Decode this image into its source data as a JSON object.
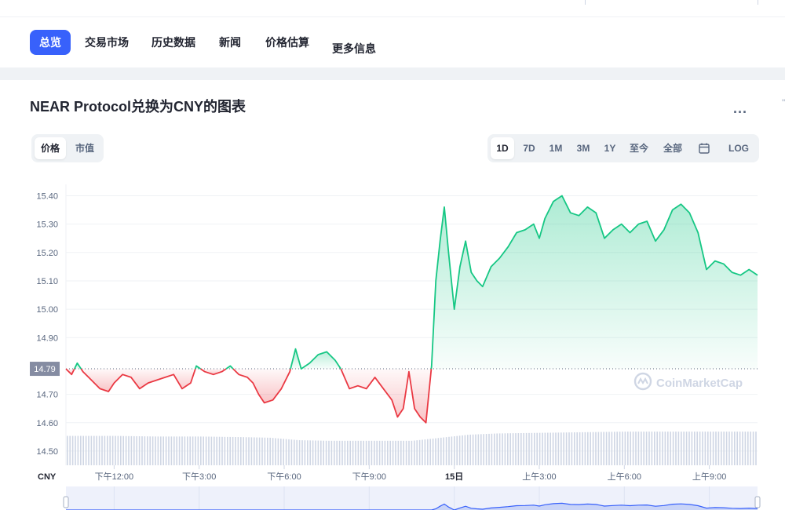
{
  "nav": {
    "items": [
      {
        "label": "总览",
        "active": true
      },
      {
        "label": "交易市场",
        "active": false
      },
      {
        "label": "历史数据",
        "active": false
      },
      {
        "label": "新闻",
        "active": false
      },
      {
        "label": "价格估算",
        "active": false
      },
      {
        "label": "更多信息",
        "active": false
      }
    ]
  },
  "chart_header": {
    "title": "NEAR Protocol兑换为CNY的图表",
    "more_label": "...",
    "edge_mark": "\"",
    "view_toggle": [
      "价格",
      "市值"
    ],
    "view_active": "价格",
    "ranges": [
      "1D",
      "7D",
      "1M",
      "3M",
      "1Y",
      "至今",
      "全部"
    ],
    "range_active": "1D",
    "calendar_icon": "calendar-icon",
    "log_label": "LOG"
  },
  "colors": {
    "up": "#16c784",
    "down": "#ea3943",
    "accent": "#3861fb",
    "volume": "#cfd6e4"
  },
  "chart_data": {
    "type": "line",
    "currency_label": "CNY",
    "watermark": "CoinMarketCap",
    "baseline_value": 14.79,
    "baseline_label": "14.79",
    "ylim": [
      14.45,
      15.44
    ],
    "yticks": [
      15.4,
      15.3,
      15.2,
      15.1,
      15.0,
      14.9,
      14.7,
      14.6,
      14.5
    ],
    "ytick_labels": [
      "15.40",
      "15.30",
      "15.20",
      "15.10",
      "15.00",
      "14.90",
      "14.70",
      "14.60",
      "14.50"
    ],
    "x_range_hours": [
      10.3,
      34.7
    ],
    "xticks": [
      {
        "hour": 12,
        "label": "下午12:00",
        "bold": false
      },
      {
        "hour": 15,
        "label": "下午3:00",
        "bold": false
      },
      {
        "hour": 18,
        "label": "下午6:00",
        "bold": false
      },
      {
        "hour": 21,
        "label": "下午9:00",
        "bold": false
      },
      {
        "hour": 24,
        "label": "15日",
        "bold": true
      },
      {
        "hour": 27,
        "label": "上午3:00",
        "bold": false
      },
      {
        "hour": 30,
        "label": "上午6:00",
        "bold": false
      },
      {
        "hour": 33,
        "label": "上午9:00",
        "bold": false
      }
    ],
    "series": [
      {
        "points": [
          [
            10.3,
            14.79
          ],
          [
            10.5,
            14.77
          ],
          [
            10.7,
            14.81
          ],
          [
            10.9,
            14.78
          ],
          [
            11.1,
            14.76
          ],
          [
            11.3,
            14.74
          ],
          [
            11.5,
            14.72
          ],
          [
            11.8,
            14.71
          ],
          [
            12.0,
            14.74
          ],
          [
            12.3,
            14.77
          ],
          [
            12.6,
            14.76
          ],
          [
            12.9,
            14.72
          ],
          [
            13.2,
            14.74
          ],
          [
            13.5,
            14.75
          ],
          [
            13.8,
            14.76
          ],
          [
            14.1,
            14.77
          ],
          [
            14.4,
            14.72
          ],
          [
            14.7,
            14.74
          ],
          [
            14.9,
            14.8
          ],
          [
            15.2,
            14.78
          ],
          [
            15.5,
            14.77
          ],
          [
            15.8,
            14.78
          ],
          [
            16.1,
            14.8
          ],
          [
            16.4,
            14.77
          ],
          [
            16.7,
            14.76
          ],
          [
            16.9,
            14.74
          ],
          [
            17.1,
            14.7
          ],
          [
            17.3,
            14.67
          ],
          [
            17.6,
            14.68
          ],
          [
            17.9,
            14.72
          ],
          [
            18.2,
            14.78
          ],
          [
            18.4,
            14.86
          ],
          [
            18.6,
            14.79
          ],
          [
            18.9,
            14.81
          ],
          [
            19.2,
            14.84
          ],
          [
            19.5,
            14.85
          ],
          [
            19.8,
            14.82
          ],
          [
            20.0,
            14.79
          ],
          [
            20.3,
            14.72
          ],
          [
            20.6,
            14.73
          ],
          [
            20.9,
            14.72
          ],
          [
            21.2,
            14.76
          ],
          [
            21.5,
            14.72
          ],
          [
            21.8,
            14.68
          ],
          [
            22.0,
            14.62
          ],
          [
            22.2,
            14.65
          ],
          [
            22.4,
            14.78
          ],
          [
            22.6,
            14.65
          ],
          [
            22.8,
            14.62
          ],
          [
            23.0,
            14.6
          ],
          [
            23.2,
            14.8
          ],
          [
            23.35,
            15.1
          ],
          [
            23.5,
            15.24
          ],
          [
            23.65,
            15.36
          ],
          [
            23.8,
            15.2
          ],
          [
            24.0,
            15.0
          ],
          [
            24.2,
            15.15
          ],
          [
            24.4,
            15.24
          ],
          [
            24.6,
            15.13
          ],
          [
            24.8,
            15.1
          ],
          [
            25.0,
            15.08
          ],
          [
            25.3,
            15.15
          ],
          [
            25.6,
            15.18
          ],
          [
            25.9,
            15.22
          ],
          [
            26.2,
            15.27
          ],
          [
            26.5,
            15.28
          ],
          [
            26.8,
            15.3
          ],
          [
            27.0,
            15.25
          ],
          [
            27.2,
            15.32
          ],
          [
            27.5,
            15.38
          ],
          [
            27.8,
            15.4
          ],
          [
            28.1,
            15.34
          ],
          [
            28.4,
            15.33
          ],
          [
            28.7,
            15.36
          ],
          [
            29.0,
            15.34
          ],
          [
            29.3,
            15.25
          ],
          [
            29.6,
            15.28
          ],
          [
            29.9,
            15.3
          ],
          [
            30.2,
            15.27
          ],
          [
            30.5,
            15.3
          ],
          [
            30.8,
            15.31
          ],
          [
            31.1,
            15.24
          ],
          [
            31.4,
            15.28
          ],
          [
            31.7,
            15.35
          ],
          [
            32.0,
            15.37
          ],
          [
            32.3,
            15.34
          ],
          [
            32.6,
            15.27
          ],
          [
            32.9,
            15.14
          ],
          [
            33.2,
            15.17
          ],
          [
            33.5,
            15.16
          ],
          [
            33.8,
            15.13
          ],
          [
            34.1,
            15.12
          ],
          [
            34.4,
            15.14
          ],
          [
            34.7,
            15.12
          ]
        ],
        "volume": [
          [
            10.3,
            0.48
          ],
          [
            12.0,
            0.48
          ],
          [
            13.5,
            0.47
          ],
          [
            15.0,
            0.47
          ],
          [
            16.5,
            0.46
          ],
          [
            17.5,
            0.45
          ],
          [
            18.5,
            0.41
          ],
          [
            19.5,
            0.4
          ],
          [
            21.0,
            0.4
          ],
          [
            22.5,
            0.4
          ],
          [
            23.5,
            0.45
          ],
          [
            24.5,
            0.5
          ],
          [
            25.5,
            0.52
          ],
          [
            27.0,
            0.53
          ],
          [
            28.5,
            0.54
          ],
          [
            30.0,
            0.55
          ],
          [
            31.5,
            0.55
          ],
          [
            33.0,
            0.55
          ],
          [
            34.7,
            0.55
          ]
        ]
      }
    ]
  }
}
